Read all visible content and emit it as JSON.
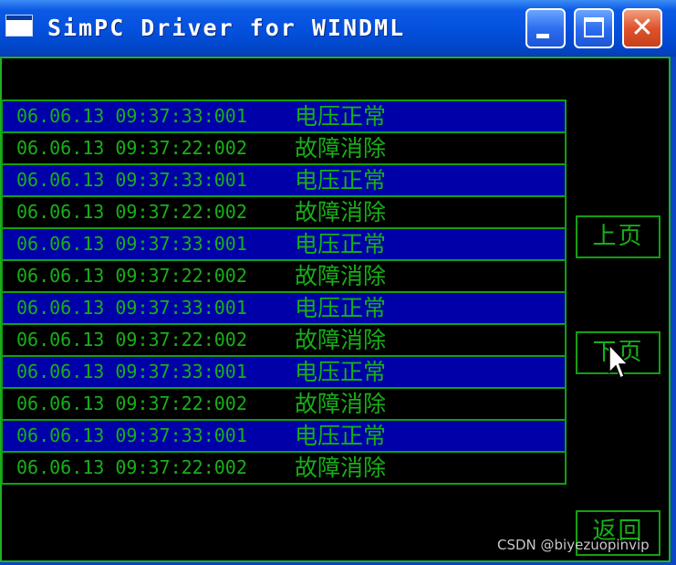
{
  "window": {
    "title": "SimPC Driver for WINDML",
    "controls": {
      "minimize_icon": "minimize-icon",
      "maximize_icon": "maximize-icon",
      "close_glyph": "✕"
    }
  },
  "log": {
    "rows": [
      {
        "timestamp": "06.06.13 09:37:33:001",
        "message": "电压正常"
      },
      {
        "timestamp": "06.06.13 09:37:22:002",
        "message": "故障消除"
      },
      {
        "timestamp": "06.06.13 09:37:33:001",
        "message": "电压正常"
      },
      {
        "timestamp": "06.06.13 09:37:22:002",
        "message": "故障消除"
      },
      {
        "timestamp": "06.06.13 09:37:33:001",
        "message": "电压正常"
      },
      {
        "timestamp": "06.06.13 09:37:22:002",
        "message": "故障消除"
      },
      {
        "timestamp": "06.06.13 09:37:33:001",
        "message": "电压正常"
      },
      {
        "timestamp": "06.06.13 09:37:22:002",
        "message": "故障消除"
      },
      {
        "timestamp": "06.06.13 09:37:33:001",
        "message": "电压正常"
      },
      {
        "timestamp": "06.06.13 09:37:22:002",
        "message": "故障消除"
      },
      {
        "timestamp": "06.06.13 09:37:33:001",
        "message": "电压正常"
      },
      {
        "timestamp": "06.06.13 09:37:22:002",
        "message": "故障消除"
      }
    ]
  },
  "buttons": {
    "prev_page": "上页",
    "next_page": "下页",
    "back": "返回"
  },
  "watermark": "CSDN @biyezuopinvip",
  "colors": {
    "text_green": "#17b017",
    "border_green": "#12a012",
    "row_highlight": "#0000a8",
    "background": "#000000"
  }
}
